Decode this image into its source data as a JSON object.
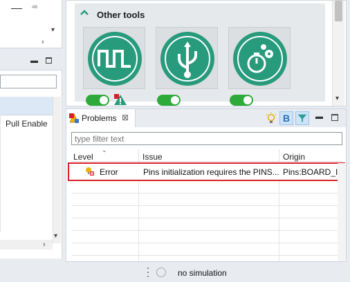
{
  "left_top": {
    "small_text": "AB"
  },
  "left_bottom": {
    "column_header": "Pull Enable"
  },
  "tools": {
    "section_title": "Other tools",
    "cards": [
      {
        "icon": "pulse-wave-icon",
        "enabled": true,
        "warning": true
      },
      {
        "icon": "usb-icon",
        "enabled": true,
        "warning": false
      },
      {
        "icon": "clock-gears-icon",
        "enabled": true,
        "warning": false
      }
    ]
  },
  "problems": {
    "tab_label": "Problems",
    "close_glyph": "⊠",
    "filter_placeholder": "type filter text",
    "columns": {
      "level": "Level",
      "issue": "Issue",
      "origin": "Origin"
    },
    "rows": [
      {
        "level": "Error",
        "issue": "Pins initialization requires the PINS...",
        "origin": "Pins:BOARD_Init"
      }
    ],
    "toolbar": {
      "b_label": "B"
    }
  },
  "status": {
    "text": "no simulation"
  },
  "colors": {
    "accent": "#279b7c",
    "toggle_on": "#2eaa3a",
    "error_outline": "#d91f26",
    "selected_button": "#cde3f7"
  }
}
